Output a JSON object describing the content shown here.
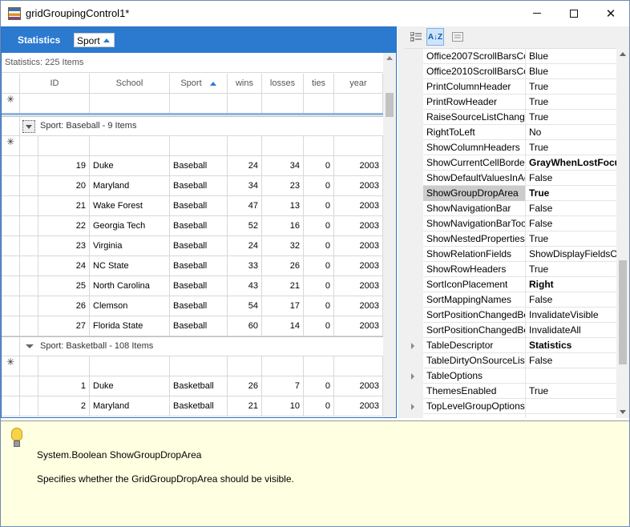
{
  "window": {
    "title": "gridGroupingControl1*",
    "minimize_icon": "minimize-icon",
    "maximize_icon": "maximize-icon",
    "close_icon": "close-icon",
    "close_glyph": "✕"
  },
  "group_drop_area": {
    "title": "Statistics",
    "chip_label": "Sport"
  },
  "statistics_text": "Statistics: 225 Items",
  "grid": {
    "columns": [
      "ID",
      "School",
      "Sport",
      "wins",
      "losses",
      "ties",
      "year"
    ],
    "add_row_glyph": "✳",
    "groups": [
      {
        "caption": "Sport: Baseball - 9 Items",
        "rows": [
          [
            "19",
            "Duke",
            "Baseball",
            "24",
            "34",
            "0",
            "2003"
          ],
          [
            "20",
            "Maryland",
            "Baseball",
            "34",
            "23",
            "0",
            "2003"
          ],
          [
            "21",
            "Wake Forest",
            "Baseball",
            "47",
            "13",
            "0",
            "2003"
          ],
          [
            "22",
            "Georgia Tech",
            "Baseball",
            "52",
            "16",
            "0",
            "2003"
          ],
          [
            "23",
            "Virginia",
            "Baseball",
            "24",
            "32",
            "0",
            "2003"
          ],
          [
            "24",
            "NC State",
            "Baseball",
            "33",
            "26",
            "0",
            "2003"
          ],
          [
            "25",
            "North Carolina",
            "Baseball",
            "43",
            "21",
            "0",
            "2003"
          ],
          [
            "26",
            "Clemson",
            "Baseball",
            "54",
            "17",
            "0",
            "2003"
          ],
          [
            "27",
            "Florida State",
            "Baseball",
            "60",
            "14",
            "0",
            "2003"
          ]
        ]
      },
      {
        "caption": "Sport: Basketball - 108 Items",
        "rows": [
          [
            "1",
            "Duke",
            "Basketball",
            "26",
            "7",
            "0",
            "2003"
          ],
          [
            "2",
            "Maryland",
            "Basketball",
            "21",
            "10",
            "0",
            "2003"
          ]
        ]
      }
    ]
  },
  "property_grid": {
    "toolbar": {
      "categorized_icon": "categorized-icon",
      "alphabetical_label": "A↓Z",
      "property_pages_icon": "property-pages-icon"
    },
    "rows": [
      {
        "name": "Office2007ScrollBarsCo",
        "value": "Blue",
        "bold": false,
        "expandable": false
      },
      {
        "name": "Office2010ScrollBarsCo",
        "value": "Blue",
        "bold": false,
        "expandable": false
      },
      {
        "name": "PrintColumnHeader",
        "value": "True",
        "bold": false,
        "expandable": false
      },
      {
        "name": "PrintRowHeader",
        "value": "True",
        "bold": false,
        "expandable": false
      },
      {
        "name": "RaiseSourceListChange",
        "value": "True",
        "bold": false,
        "expandable": false
      },
      {
        "name": "RightToLeft",
        "value": "No",
        "bold": false,
        "expandable": false
      },
      {
        "name": "ShowColumnHeaders",
        "value": "True",
        "bold": false,
        "expandable": false
      },
      {
        "name": "ShowCurrentCellBorder",
        "value": "GrayWhenLostFocu",
        "bold": true,
        "expandable": false
      },
      {
        "name": "ShowDefaultValuesInAc",
        "value": "False",
        "bold": false,
        "expandable": false
      },
      {
        "name": "ShowGroupDropArea",
        "value": "True",
        "bold": true,
        "expandable": false,
        "selected": true
      },
      {
        "name": "ShowNavigationBar",
        "value": "False",
        "bold": false,
        "expandable": false
      },
      {
        "name": "ShowNavigationBarToo",
        "value": "False",
        "bold": false,
        "expandable": false
      },
      {
        "name": "ShowNestedPropertiesF",
        "value": "True",
        "bold": false,
        "expandable": false
      },
      {
        "name": "ShowRelationFields",
        "value": "ShowDisplayFieldsOn",
        "bold": false,
        "expandable": false
      },
      {
        "name": "ShowRowHeaders",
        "value": "True",
        "bold": false,
        "expandable": false
      },
      {
        "name": "SortIconPlacement",
        "value": "Right",
        "bold": true,
        "expandable": false
      },
      {
        "name": "SortMappingNames",
        "value": "False",
        "bold": false,
        "expandable": false
      },
      {
        "name": "SortPositionChangedBe",
        "value": "InvalidateVisible",
        "bold": false,
        "expandable": false
      },
      {
        "name": "SortPositionChangedBe",
        "value": "InvalidateAll",
        "bold": false,
        "expandable": false
      },
      {
        "name": "TableDescriptor",
        "value": "Statistics",
        "bold": true,
        "expandable": true
      },
      {
        "name": "TableDirtyOnSourceList",
        "value": "False",
        "bold": false,
        "expandable": false
      },
      {
        "name": "TableOptions",
        "value": "",
        "bold": false,
        "expandable": true
      },
      {
        "name": "ThemesEnabled",
        "value": "True",
        "bold": false,
        "expandable": false
      },
      {
        "name": "TopLevelGroupOptions",
        "value": "",
        "bold": false,
        "expandable": true
      },
      {
        "name": "",
        "value": "",
        "bold": false,
        "expandable": false
      }
    ]
  },
  "description": {
    "icon": "lightbulb-icon",
    "title": "System.Boolean ShowGroupDropArea",
    "text": "Specifies whether the GridGroupDropArea should be visible."
  }
}
